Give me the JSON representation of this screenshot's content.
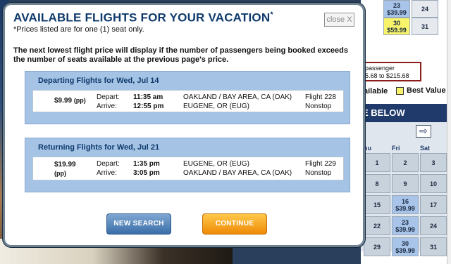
{
  "modal": {
    "title": "AVAILABLE FLIGHTS FOR YOUR VACATION",
    "title_mark": "*",
    "subtitle": "*Prices listed are for one (1) seat only.",
    "close_label": "close X",
    "notice": "The next lowest flight price will display if the number of passengers being booked exceeds the number of seats available at the previous page's price."
  },
  "departing": {
    "heading": "Departing Flights for Wed, Jul 14",
    "price": "$9.99",
    "price_unit": "(pp)",
    "depart_label": "Depart:",
    "arrive_label": "Arrive:",
    "depart_time": "11:35 am",
    "arrive_time": "12:55 pm",
    "origin": "OAKLAND / BAY AREA, CA (OAK)",
    "destination": "EUGENE, OR (EUG)",
    "flight": "Flight 228",
    "stops": "Nonstop"
  },
  "returning": {
    "heading": "Returning Flights for Wed, Jul 21",
    "price": "$19.99",
    "price_unit": "(pp)",
    "depart_label": "Depart:",
    "arrive_label": "Arrive:",
    "depart_time": "1:35 pm",
    "arrive_time": "3:05 pm",
    "origin": "EUGENE, OR (EUG)",
    "destination": "OAKLAND / BAY AREA, CA (OAK)",
    "flight": "Flight 229",
    "stops": "Nonstop"
  },
  "buttons": {
    "new_search": "NEW SEARCH",
    "continue": "CONTINUE"
  },
  "background": {
    "top_cal": [
      {
        "day": "23",
        "price": "$39.99",
        "style": "price"
      },
      {
        "day": "24",
        "price": "",
        "style": "white"
      },
      {
        "day": "30",
        "price": "$59.99",
        "style": "best"
      },
      {
        "day": "31",
        "price": "",
        "style": "white"
      }
    ],
    "passenger_text": "passenger",
    "passenger_range": "5.68 to $215.68",
    "legend_available": "ailable",
    "legend_best": "Best Value",
    "below_title": "E BELOW",
    "next_arrow": "⇨",
    "dow": [
      "hu",
      "Fri",
      "Sat"
    ],
    "rows": [
      [
        {
          "d": "1",
          "p": ""
        },
        {
          "d": "2",
          "p": ""
        },
        {
          "d": "3",
          "p": ""
        }
      ],
      [
        {
          "d": "8",
          "p": ""
        },
        {
          "d": "9",
          "p": ""
        },
        {
          "d": "10",
          "p": ""
        }
      ],
      [
        {
          "d": "15",
          "p": ""
        },
        {
          "d": "16",
          "p": "$39.99"
        },
        {
          "d": "17",
          "p": ""
        }
      ],
      [
        {
          "d": "22",
          "p": ""
        },
        {
          "d": "23",
          "p": "$39.99"
        },
        {
          "d": "24",
          "p": ""
        }
      ],
      [
        {
          "d": "29",
          "p": ""
        },
        {
          "d": "30",
          "p": "$39.99"
        },
        {
          "d": "31",
          "p": ""
        }
      ]
    ]
  },
  "colors": {
    "title_blue": "#0e3a6b",
    "flight_panel": "#a5c3e5",
    "continue_orange": "#ef8a07",
    "new_search_blue": "#3a6ea8",
    "best_value_yellow": "#f7f46c"
  }
}
